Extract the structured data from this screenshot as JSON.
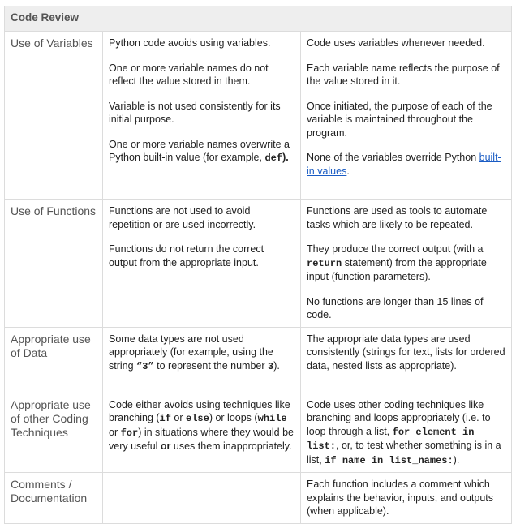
{
  "title": "Code Review",
  "colors": {
    "link": "#1a5cc4",
    "header_bg": "#eeeeee",
    "border": "#dcdcdc"
  },
  "rows": [
    {
      "criterion": "Use of Variables",
      "poor": [
        [
          {
            "t": "Python code avoids using variables."
          }
        ],
        [
          {
            "t": "One or more variable names do not reflect the value stored in them."
          }
        ],
        [
          {
            "t": "Variable is not used consistently for its initial purpose."
          }
        ],
        [
          {
            "t": "One or more variable names overwrite a Python built-in value (for example, "
          },
          {
            "t": "def",
            "s": "code"
          },
          {
            "t": ").",
            "s": "bold"
          }
        ]
      ],
      "good": [
        [
          {
            "t": "Code uses variables whenever needed."
          }
        ],
        [
          {
            "t": "Each variable name reflects the purpose of the value stored in it."
          }
        ],
        [
          {
            "t": "Once initiated, the purpose of each of the variable is maintained throughout the program."
          }
        ],
        [
          {
            "t": "None of the variables override Python "
          },
          {
            "t": "built-in values",
            "s": "link"
          },
          {
            "t": "."
          }
        ]
      ]
    },
    {
      "criterion": "Use of Functions",
      "poor": [
        [
          {
            "t": "Functions are not used to avoid repetition or are used incorrectly."
          }
        ],
        [
          {
            "t": "Functions do not return the correct output from the appropriate input."
          }
        ]
      ],
      "good": [
        [
          {
            "t": "Functions are used as tools to automate tasks which are likely to be repeated."
          }
        ],
        [
          {
            "t": "They produce the correct output (with a "
          },
          {
            "t": "return",
            "s": "code"
          },
          {
            "t": " statement) from the appropriate input (function parameters)."
          }
        ],
        [
          {
            "t": "No functions are longer than 15 lines of code."
          }
        ]
      ]
    },
    {
      "criterion": "Appropriate use of Data",
      "poor": [
        [
          {
            "t": "Some data types are not used appropriately (for example, using the string "
          },
          {
            "t": "“3”",
            "s": "code"
          },
          {
            "t": " to represent the number "
          },
          {
            "t": "3",
            "s": "code"
          },
          {
            "t": ")."
          }
        ]
      ],
      "good": [
        [
          {
            "t": "The appropriate data types are used consistently (strings for text, lists for ordered data, nested lists as appropriate)."
          }
        ]
      ]
    },
    {
      "criterion": "Appropriate use of other Coding Techniques",
      "poor": [
        [
          {
            "t": "Code either avoids using techniques like branching ("
          },
          {
            "t": "if",
            "s": "code"
          },
          {
            "t": " or "
          },
          {
            "t": "else",
            "s": "code"
          },
          {
            "t": ") or loops ("
          },
          {
            "t": "while",
            "s": "code"
          },
          {
            "t": " or "
          },
          {
            "t": "for",
            "s": "code"
          },
          {
            "t": ") in situations where they would be very useful "
          },
          {
            "t": "or",
            "s": "bold"
          },
          {
            "t": " uses them inappropriately."
          }
        ]
      ],
      "good": [
        [
          {
            "t": "Code uses other coding techniques like branching and loops appropriately (i.e. to loop through a list, "
          },
          {
            "t": "for element in list:",
            "s": "code"
          },
          {
            "t": ", or, to test whether something is in a list, "
          },
          {
            "t": "if name in list_names:",
            "s": "code"
          },
          {
            "t": ")."
          }
        ]
      ]
    },
    {
      "criterion": "Comments / Documentation",
      "poor": [],
      "good": [
        [
          {
            "t": "Each function includes a comment which explains the behavior, inputs, and outputs (when applicable)."
          }
        ]
      ]
    }
  ]
}
